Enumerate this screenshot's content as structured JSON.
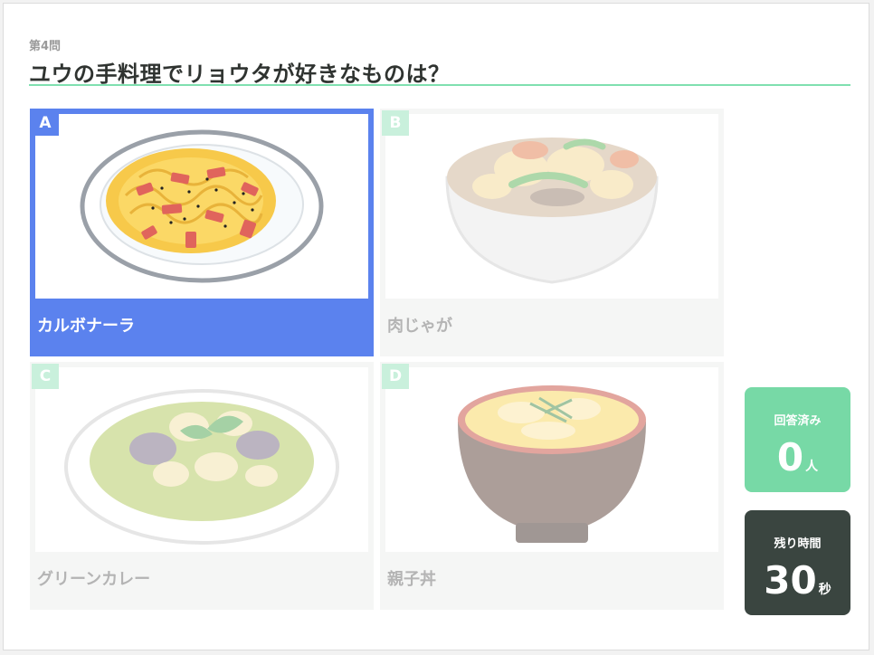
{
  "question": {
    "number": "第4問",
    "title": "ユウの手料理でリョウタが好きなものは？"
  },
  "choices": [
    {
      "letter": "A",
      "label": "カルボナーラ",
      "icon": "carbonara-illustration",
      "selected": true
    },
    {
      "letter": "B",
      "label": "肉じゃが",
      "icon": "nikujaga-illustration",
      "selected": false
    },
    {
      "letter": "C",
      "label": "グリーンカレー",
      "icon": "green-curry-illustration",
      "selected": false
    },
    {
      "letter": "D",
      "label": "親子丼",
      "icon": "oyakodon-illustration",
      "selected": false
    }
  ],
  "stats": {
    "answered_caption": "回答済み",
    "answered_value": "0",
    "answered_unit": "人",
    "time_caption": "残り時間",
    "time_value": "30",
    "time_unit": "秒"
  },
  "colors": {
    "accent_line": "#7fe0b0",
    "selected": "#5b82ee",
    "answered_bg": "#77d9a6",
    "timer_bg": "#3a4540",
    "letter_badge": "#c9f0dc"
  }
}
